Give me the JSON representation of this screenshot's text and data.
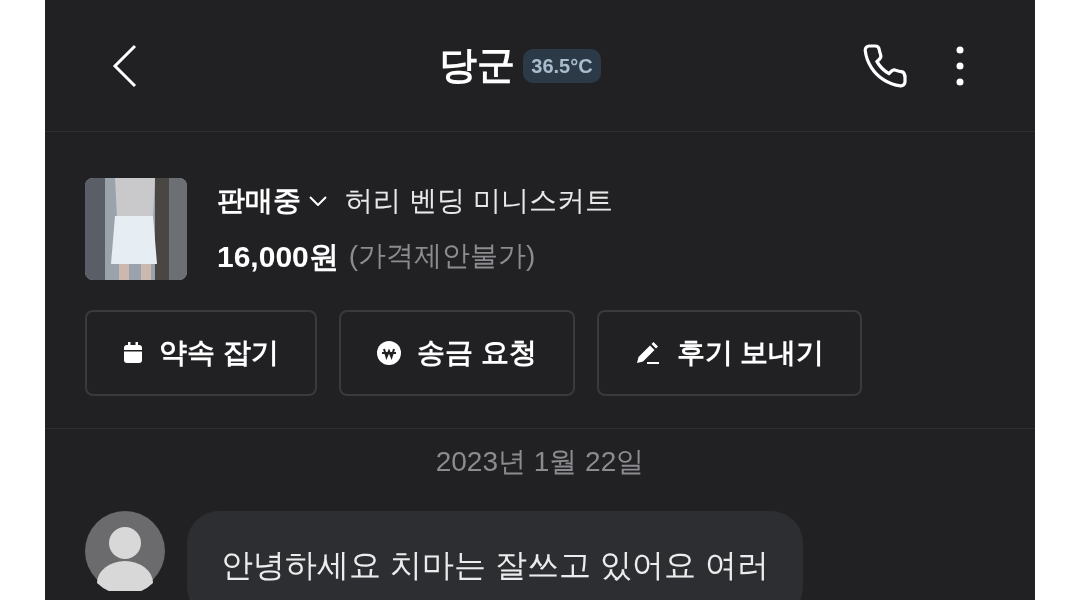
{
  "header": {
    "title": "당군",
    "temperature": "36.5°C"
  },
  "product": {
    "status": "판매중",
    "name": "허리 벤딩 미니스커트",
    "price": "16,000원",
    "price_note": "(가격제안불가)"
  },
  "actions": [
    {
      "kind": "calendar",
      "label": "약속 잡기"
    },
    {
      "kind": "won",
      "label": "송금 요청"
    },
    {
      "kind": "pencil",
      "label": "후기 보내기"
    }
  ],
  "date": "2023년 1월 22일",
  "messages": [
    {
      "text": "안녕하세요 치마는 잘쓰고 있어요 여러"
    }
  ]
}
